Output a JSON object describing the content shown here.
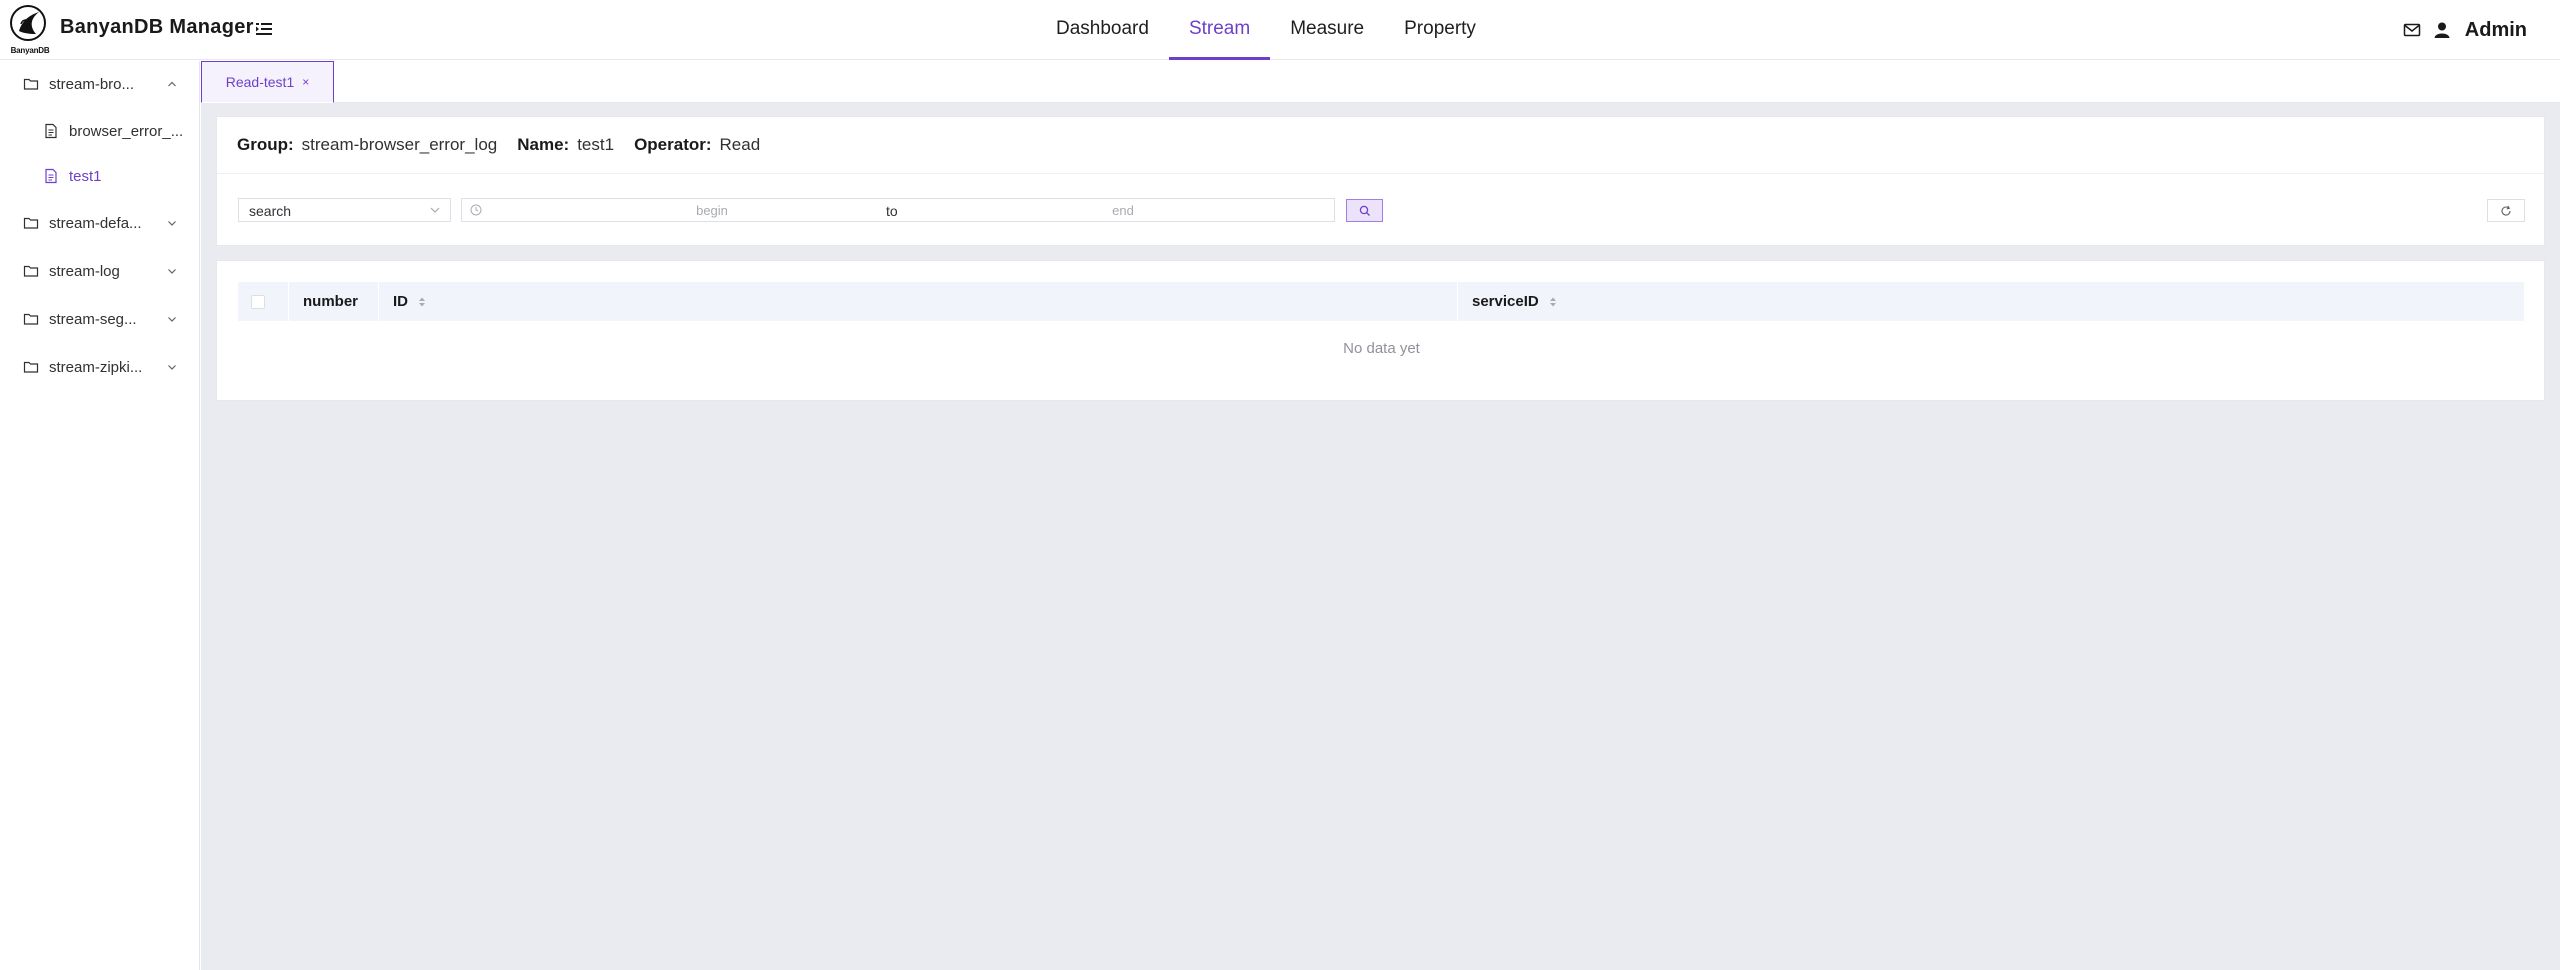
{
  "header": {
    "logo_text": "BanyanDB",
    "app_title": "BanyanDB Manager",
    "nav": [
      {
        "label": "Dashboard",
        "active": false
      },
      {
        "label": "Stream",
        "active": true
      },
      {
        "label": "Measure",
        "active": false
      },
      {
        "label": "Property",
        "active": false
      }
    ],
    "user": "Admin"
  },
  "sidebar": {
    "groups": [
      {
        "label": "stream-bro...",
        "expanded": true,
        "children": [
          {
            "label": "browser_error_...",
            "active": false
          },
          {
            "label": "test1",
            "active": true
          }
        ]
      },
      {
        "label": "stream-defa...",
        "expanded": false
      },
      {
        "label": "stream-log",
        "expanded": false
      },
      {
        "label": "stream-seg...",
        "expanded": false
      },
      {
        "label": "stream-zipki...",
        "expanded": false
      }
    ]
  },
  "tabs": [
    {
      "label": "Read-test1",
      "close": "×",
      "active": true
    }
  ],
  "info": {
    "group_key": "Group:",
    "group_value": "stream-browser_error_log",
    "name_key": "Name:",
    "name_value": "test1",
    "operator_key": "Operator:",
    "operator_value": "Read"
  },
  "filters": {
    "select_value": "search",
    "begin_placeholder": "begin",
    "separator": "to",
    "end_placeholder": "end"
  },
  "table": {
    "columns": [
      "number",
      "ID",
      "serviceID"
    ],
    "empty_text": "No data yet"
  },
  "colors": {
    "accent": "#6e40c9",
    "background": "#e9ebf0",
    "table_header": "#f1f4fb"
  }
}
